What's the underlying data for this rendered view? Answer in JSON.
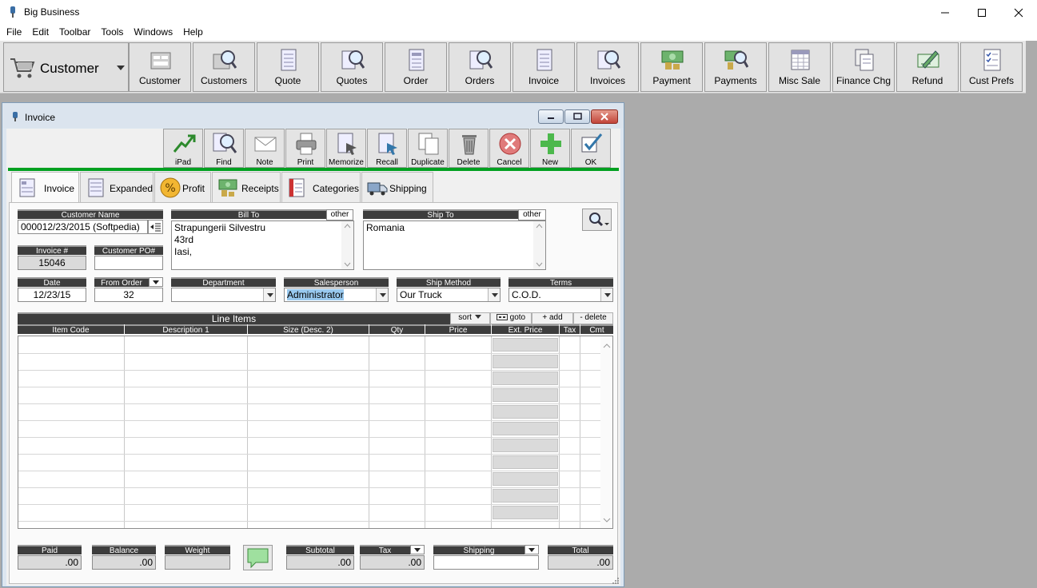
{
  "app": {
    "title": "Big Business"
  },
  "menu": [
    "File",
    "Edit",
    "Toolbar",
    "Tools",
    "Windows",
    "Help"
  ],
  "toolbar": {
    "dropdown_label": "Customer",
    "buttons": [
      "Customer",
      "Customers",
      "Quote",
      "Quotes",
      "Order",
      "Orders",
      "Invoice",
      "Invoices",
      "Payment",
      "Payments",
      "Misc Sale",
      "Finance Chg",
      "Refund",
      "Cust Prefs"
    ]
  },
  "window": {
    "title": "Invoice"
  },
  "actions": [
    "iPad",
    "Find",
    "Note",
    "Print",
    "Memorize",
    "Recall",
    "Duplicate",
    "Delete",
    "Cancel",
    "New",
    "OK"
  ],
  "tabs": [
    "Invoice",
    "Expanded",
    "Profit",
    "Receipts",
    "Categories",
    "Shipping"
  ],
  "form": {
    "customer_name_label": "Customer Name",
    "customer_name": "000012/23/2015 (Softpedia)",
    "bill_to_label": "Bill To",
    "bill_to_other": "other",
    "bill_to_lines": [
      "Strapungerii Silvestru",
      "43rd",
      "Iasi,"
    ],
    "ship_to_label": "Ship To",
    "ship_to_other": "other",
    "ship_to": "Romania",
    "invoice_no_label": "Invoice #",
    "invoice_no": "15046",
    "customer_po_label": "Customer PO#",
    "customer_po": "",
    "date_label": "Date",
    "date": "12/23/15",
    "from_order_label": "From Order",
    "from_order": "32",
    "department_label": "Department",
    "department": "",
    "salesperson_label": "Salesperson",
    "salesperson": "Administrator",
    "ship_method_label": "Ship Method",
    "ship_method": "Our Truck",
    "terms_label": "Terms",
    "terms": "C.O.D."
  },
  "line_items": {
    "title": "Line Items",
    "sort": "sort",
    "goto": "goto",
    "add": "+ add",
    "delete": "- delete",
    "columns": [
      "Item Code",
      "Description 1",
      "Size (Desc. 2)",
      "Qty",
      "Price",
      "Ext. Price",
      "Tax",
      "Cmt"
    ]
  },
  "totals": {
    "paid_label": "Paid",
    "paid": ".00",
    "balance_label": "Balance",
    "balance": ".00",
    "weight_label": "Weight",
    "weight": "",
    "subtotal_label": "Subtotal",
    "subtotal": ".00",
    "tax_label": "Tax",
    "tax": ".00",
    "shipping_label": "Shipping",
    "shipping": "",
    "total_label": "Total",
    "total": ".00"
  },
  "colors": {
    "accent_green": "#00a020",
    "header_dark": "#3d3d3d",
    "highlight": "#99c9ef"
  }
}
